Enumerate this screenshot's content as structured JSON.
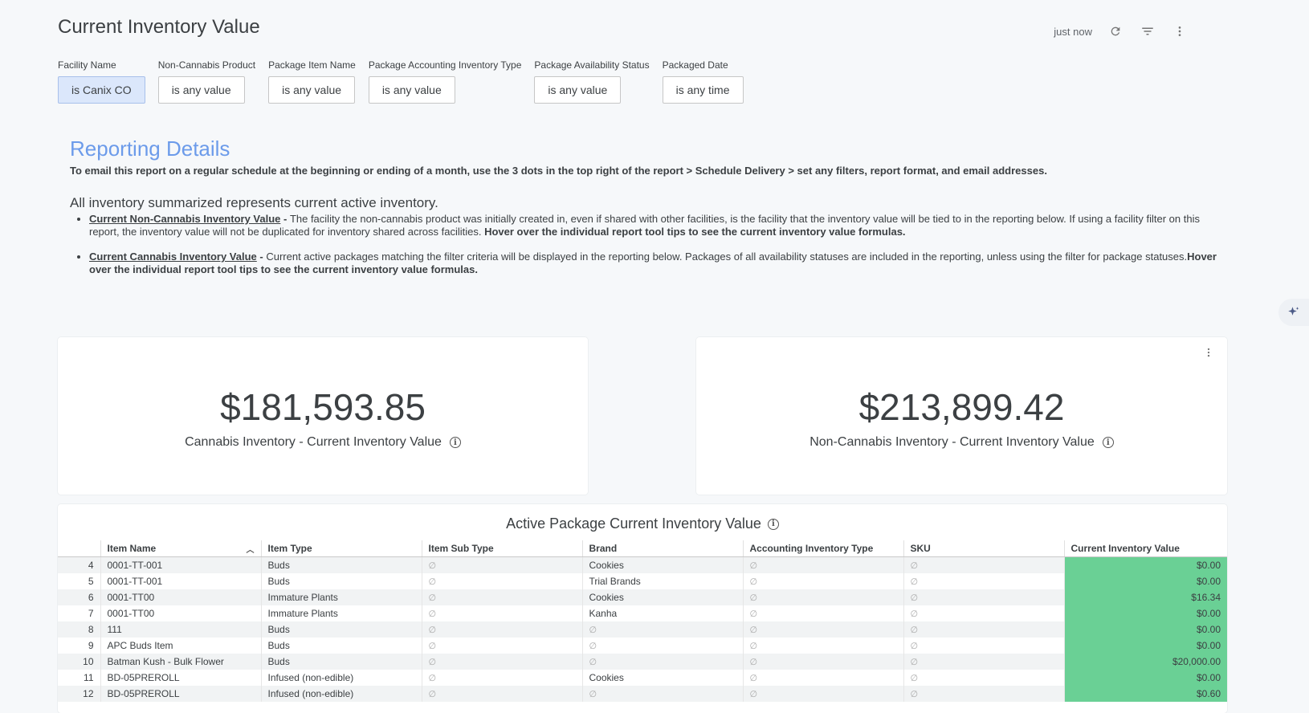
{
  "header": {
    "title": "Current Inventory Value",
    "refresh_status": "just now"
  },
  "icons": {
    "refresh": "refresh-icon",
    "filter": "filter-icon",
    "more": "more-vertical-icon",
    "info": "info-icon",
    "sort": "sort-asc-icon",
    "sparkle": "sparkle-icon"
  },
  "filters": [
    {
      "label": "Facility Name",
      "value": "is Canix CO",
      "active": true
    },
    {
      "label": "Non-Cannabis Product",
      "value": "is any value"
    },
    {
      "label": "Package Item Name",
      "value": "is any value"
    },
    {
      "label": "Package Accounting Inventory Type",
      "value": "is any value"
    },
    {
      "label": "Package Availability Status",
      "value": "is any value"
    },
    {
      "label": "Packaged Date",
      "value": "is any time"
    }
  ],
  "report": {
    "heading": "Reporting Details",
    "schedule_note": "To email this report on a regular schedule at the beginning or ending of a month, use the 3 dots in the top right of the report > Schedule Delivery > set any filters, report format, and email addresses.",
    "summary": "All inventory summarized represents current active inventory.",
    "items": [
      {
        "term": "Current Non-Cannabis Inventory Value",
        "sep": " - ",
        "text": "The facility the non-cannabis product was initially created in, even if shared with other facilities, is the facility that the inventory value will be tied to in the reporting below. If using a facility filter on this report, the inventory value will not be duplicated for inventory shared across facilities. ",
        "bold": "Hover over the individual report tool tips to see the current inventory value formulas."
      },
      {
        "term": "Current Cannabis Inventory Value",
        "sep": " - ",
        "text": "Current active packages matching the filter criteria will be displayed in the reporting below. Packages of all availability statuses are included in the reporting, unless using the filter for package statuses.",
        "bold": "Hover over the individual report tool tips to see the current inventory value formulas."
      }
    ]
  },
  "kpis": [
    {
      "value": "$181,593.85",
      "label": "Cannabis Inventory - Current Inventory Value"
    },
    {
      "value": "$213,899.42",
      "label": "Non-Cannabis Inventory - Current Inventory Value"
    }
  ],
  "table": {
    "title": "Active Package Current Inventory Value",
    "columns": [
      "Item Name",
      "Item Type",
      "Item Sub Type",
      "Brand",
      "Accounting Inventory Type",
      "SKU",
      "Current Inventory Value"
    ],
    "null_symbol": "∅",
    "rows": [
      {
        "idx": "4",
        "cells": [
          "0001-TT-001",
          "Buds",
          "∅",
          "Cookies",
          "∅",
          "∅",
          "$0.00"
        ]
      },
      {
        "idx": "5",
        "cells": [
          "0001-TT-001",
          "Buds",
          "∅",
          "Trial Brands",
          "∅",
          "∅",
          "$0.00"
        ]
      },
      {
        "idx": "6",
        "cells": [
          "0001-TT00",
          "Immature Plants",
          "∅",
          "Cookies",
          "∅",
          "∅",
          "$16.34"
        ]
      },
      {
        "idx": "7",
        "cells": [
          "0001-TT00",
          "Immature Plants",
          "∅",
          "Kanha",
          "∅",
          "∅",
          "$0.00"
        ]
      },
      {
        "idx": "8",
        "cells": [
          "111",
          "Buds",
          "∅",
          "∅",
          "∅",
          "∅",
          "$0.00"
        ]
      },
      {
        "idx": "9",
        "cells": [
          "APC Buds Item",
          "Buds",
          "∅",
          "∅",
          "∅",
          "∅",
          "$0.00"
        ]
      },
      {
        "idx": "10",
        "cells": [
          "Batman Kush - Bulk Flower",
          "Buds",
          "∅",
          "∅",
          "∅",
          "∅",
          "$20,000.00"
        ]
      },
      {
        "idx": "11",
        "cells": [
          "BD-05PREROLL",
          "Infused (non-edible)",
          "∅",
          "Cookies",
          "∅",
          "∅",
          "$0.00"
        ]
      },
      {
        "idx": "12",
        "cells": [
          "BD-05PREROLL",
          "Infused (non-edible)",
          "∅",
          "∅",
          "∅",
          "∅",
          "$0.60"
        ]
      }
    ]
  }
}
